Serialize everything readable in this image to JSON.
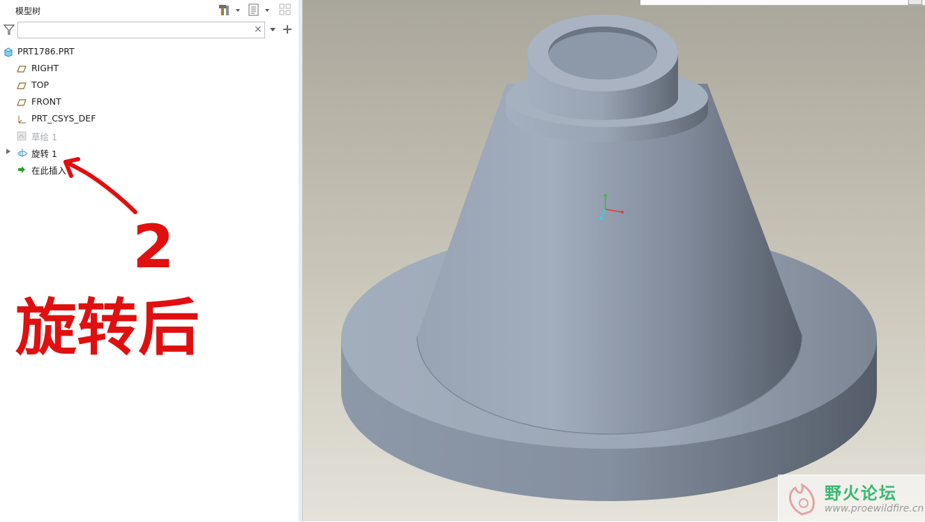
{
  "panel": {
    "title": "模型树",
    "search": {
      "value": "",
      "placeholder": ""
    }
  },
  "tree": [
    {
      "label": "PRT1786.PRT",
      "icon": "part-icon",
      "dim": false,
      "expander": false
    },
    {
      "label": "RIGHT",
      "icon": "datum-plane-icon",
      "dim": false,
      "expander": false
    },
    {
      "label": "TOP",
      "icon": "datum-plane-icon",
      "dim": false,
      "expander": false
    },
    {
      "label": "FRONT",
      "icon": "datum-plane-icon",
      "dim": false,
      "expander": false
    },
    {
      "label": "PRT_CSYS_DEF",
      "icon": "csys-icon",
      "dim": false,
      "expander": false
    },
    {
      "label": "草绘 1",
      "icon": "sketch-icon",
      "dim": true,
      "expander": false
    },
    {
      "label": "旋转 1",
      "icon": "revolve-icon",
      "dim": false,
      "expander": true
    },
    {
      "label": "在此插入",
      "icon": "insert-here-arrow-icon",
      "dim": false,
      "expander": false
    }
  ],
  "annotation": {
    "number": "2",
    "text": "旋转后",
    "color": "#e01010"
  },
  "watermark": {
    "site_name": "野火论坛",
    "url": "www.proewildfire.cn"
  },
  "colors": {
    "model": "#9aa5b5",
    "viewport_top": "#a9a69b",
    "viewport_bottom": "#e4e2d9",
    "watermark_green": "#39b870"
  }
}
